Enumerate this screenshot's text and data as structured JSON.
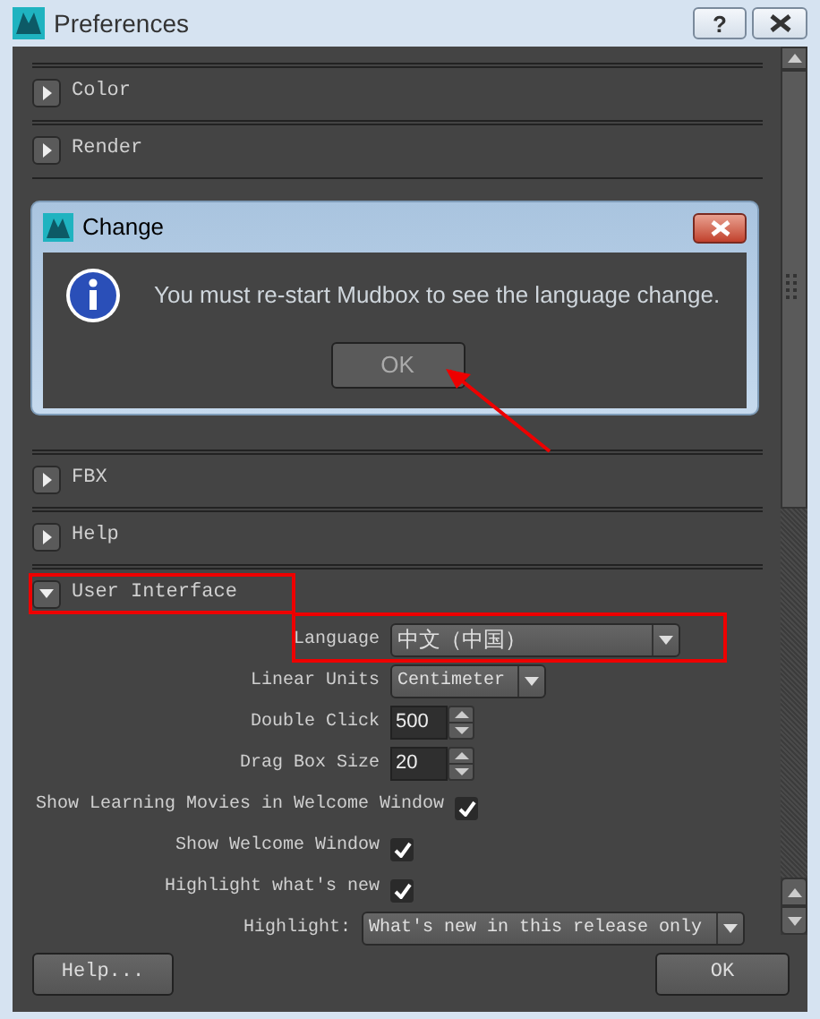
{
  "window": {
    "title": "Preferences",
    "help_button": "?"
  },
  "sections": [
    {
      "label": "Color",
      "expanded": false
    },
    {
      "label": "Render",
      "expanded": false
    },
    {
      "label": "FBX",
      "expanded": false
    },
    {
      "label": "Help",
      "expanded": false
    },
    {
      "label": "User Interface",
      "expanded": true,
      "annotated": true
    }
  ],
  "settings": [
    {
      "kind": "dropdown",
      "label": "Language",
      "value": "中文（中国）",
      "annotated": true
    },
    {
      "kind": "dropdown",
      "label": "Linear Units",
      "value": "Centimeter"
    },
    {
      "kind": "spinner",
      "label": "Double Click",
      "value": "500"
    },
    {
      "kind": "spinner",
      "label": "Drag Box Size",
      "value": "20"
    },
    {
      "kind": "checkbox",
      "label": "Show Learning Movies in Welcome Window",
      "checked": true
    },
    {
      "kind": "checkbox",
      "label": "Show Welcome Window",
      "checked": true
    },
    {
      "kind": "checkbox",
      "label": "Highlight what's new",
      "checked": true
    },
    {
      "kind": "dropdown",
      "label": "Highlight:",
      "value": "What's new in this release only"
    }
  ],
  "dialog": {
    "title": "Change",
    "message": "You must re-start Mudbox to see the language change.",
    "button": "OK"
  },
  "footer": {
    "buttons": [
      "Help...",
      "OK"
    ]
  }
}
